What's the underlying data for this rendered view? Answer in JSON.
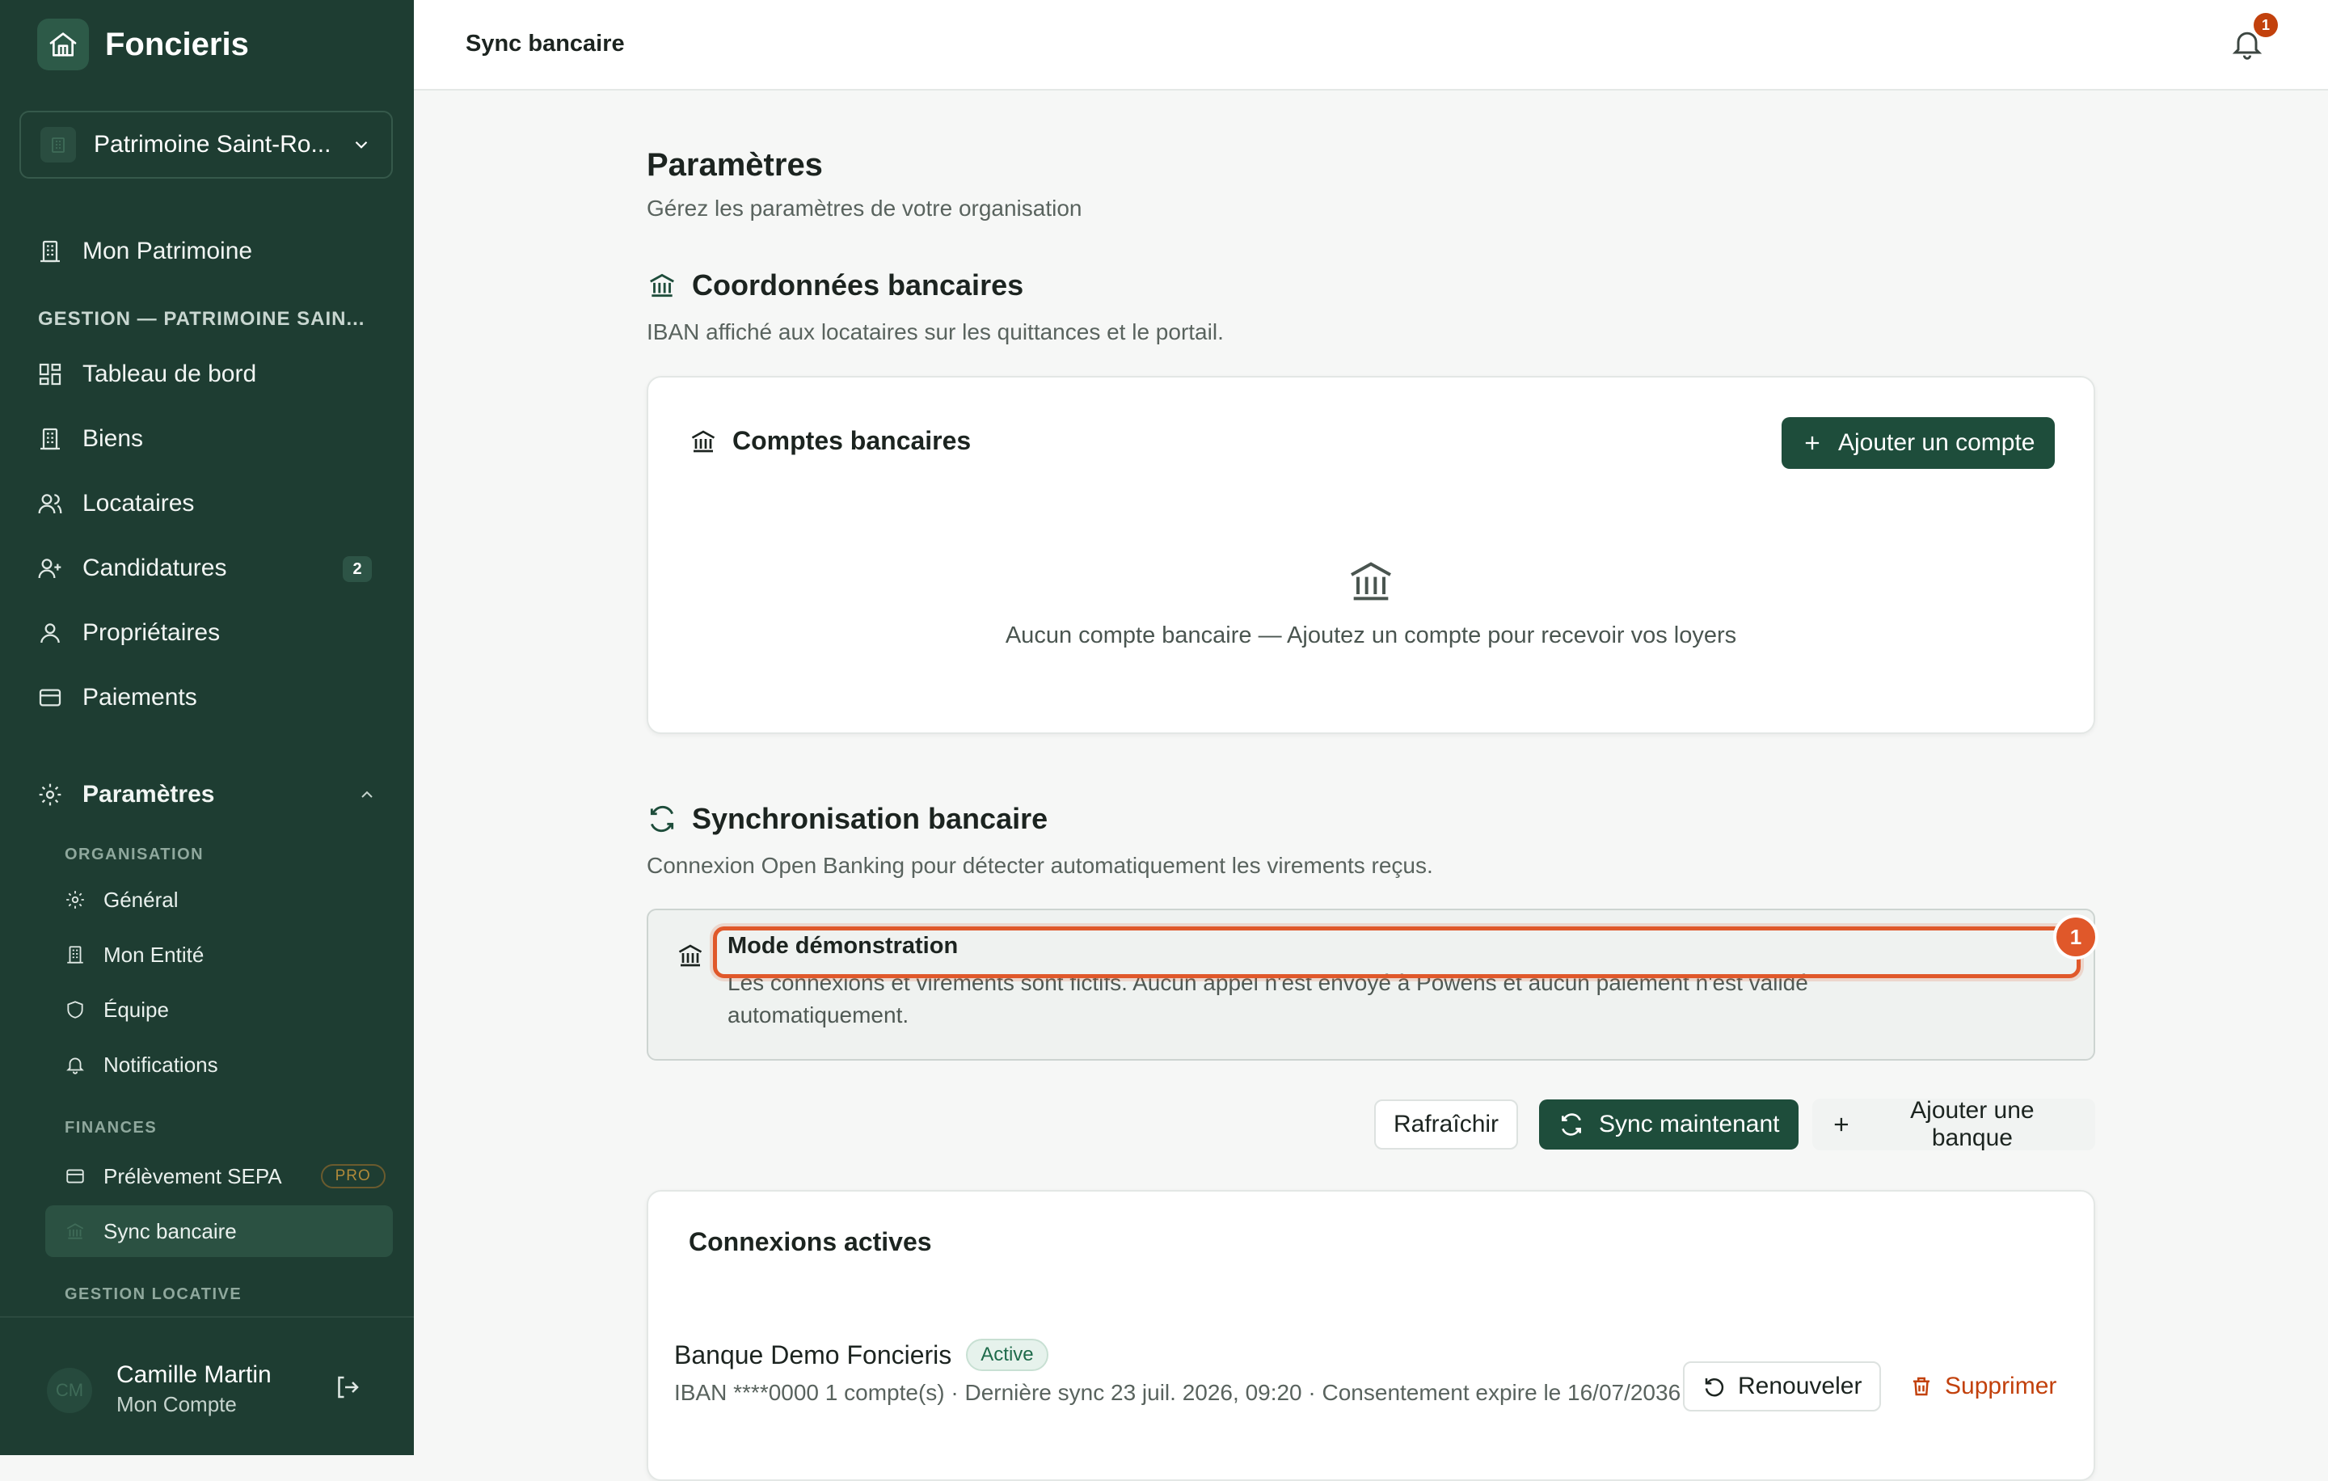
{
  "app": {
    "name": "Foncieris",
    "organization": "Patrimoine Saint-Ro..."
  },
  "sidebar": {
    "top_item": "Mon Patrimoine",
    "section_gestion": "GESTION — PATRIMOINE SAIN...",
    "items": [
      {
        "label": "Tableau de bord",
        "icon": "dashboard-icon"
      },
      {
        "label": "Biens",
        "icon": "building-icon"
      },
      {
        "label": "Locataires",
        "icon": "users-icon"
      },
      {
        "label": "Candidatures",
        "icon": "user-plus-icon",
        "badge": "2"
      },
      {
        "label": "Propriétaires",
        "icon": "user-icon"
      },
      {
        "label": "Paiements",
        "icon": "card-icon"
      }
    ],
    "settings": {
      "label": "Paramètres",
      "icon": "gear-icon"
    },
    "sub_sections": {
      "organisation": "ORGANISATION",
      "finances": "FINANCES",
      "gestion_locative": "GESTION LOCATIVE"
    },
    "organisation_items": [
      {
        "label": "Général",
        "icon": "gear-icon"
      },
      {
        "label": "Mon Entité",
        "icon": "building-icon"
      },
      {
        "label": "Équipe",
        "icon": "shield-icon"
      },
      {
        "label": "Notifications",
        "icon": "bell-icon"
      }
    ],
    "finances_items": [
      {
        "label": "Prélèvement SEPA",
        "badge": "PRO",
        "icon": "card-icon"
      },
      {
        "label": "Sync bancaire",
        "icon": "bank-icon",
        "active": true
      }
    ],
    "user": {
      "initials": "CM",
      "name": "Camille Martin",
      "role": "Mon Compte"
    }
  },
  "header": {
    "title": "Sync bancaire",
    "notification_count": "1"
  },
  "main": {
    "title": "Paramètres",
    "subtitle": "Gérez les paramètres de votre organisation",
    "bank_details": {
      "title": "Coordonnées bancaires",
      "subtitle": "IBAN affiché aux locataires sur les quittances et le portail.",
      "card_title": "Comptes bancaires",
      "add_button": "Ajouter un compte",
      "empty_text": "Aucun compte bancaire — Ajoutez un compte pour recevoir vos loyers"
    },
    "sync": {
      "title": "Synchronisation bancaire",
      "subtitle": "Connexion Open Banking pour détecter automatiquement les virements reçus.",
      "demo_title": "Mode démonstration",
      "demo_text": "Les connexions et virements sont fictifs. Aucun appel n'est envoyé à Powens et aucun paiement n'est validé automatiquement.",
      "highlight_badge": "1",
      "refresh_button": "Rafraîchir",
      "sync_button": "Sync maintenant",
      "add_bank_button": "Ajouter une banque"
    },
    "connections": {
      "title": "Connexions actives",
      "items": [
        {
          "name": "Banque Demo Foncieris",
          "status": "Active",
          "meta": "IBAN ****0000  1 compte(s)  · Dernière sync 23 juil. 2026, 09:20  · Consentement expire le 16/07/2036",
          "renew_button": "Renouveler",
          "delete_button": "Supprimer"
        }
      ]
    }
  },
  "colors": {
    "sidebar_bg": "#1e3d32",
    "primary": "#1e4d3b",
    "highlight": "#e0582a",
    "danger": "#c2410c"
  }
}
